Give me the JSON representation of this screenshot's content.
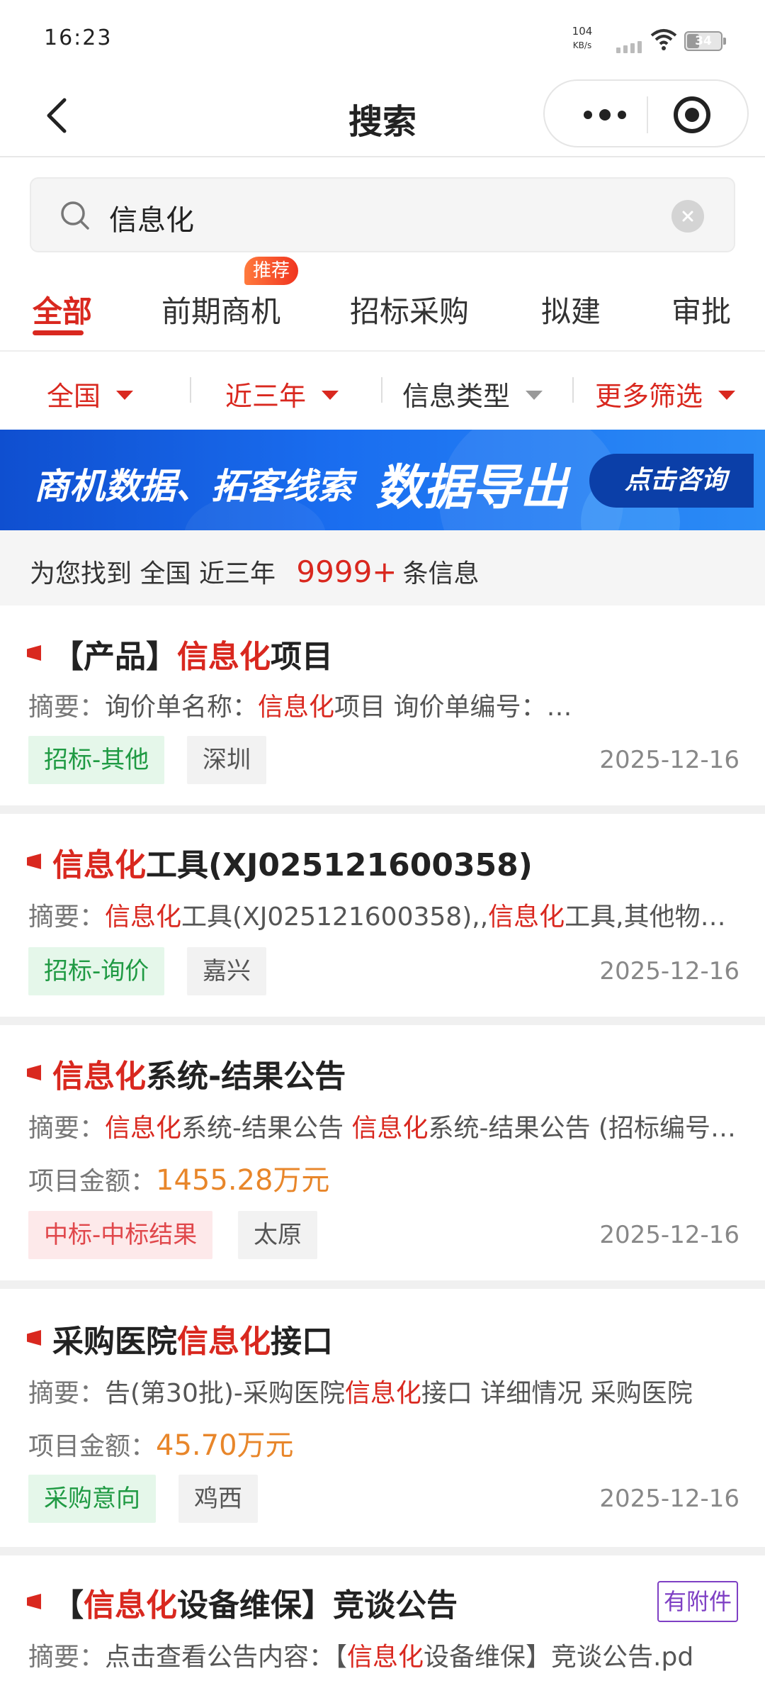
{
  "status_bar": {
    "time": "16:23",
    "net_speed": "104",
    "net_unit": "KB/s",
    "battery": "34"
  },
  "nav": {
    "title": "搜索"
  },
  "search": {
    "query": "信息化"
  },
  "tabs": [
    {
      "label": "全部",
      "active": true
    },
    {
      "label": "前期商机",
      "badge": "推荐"
    },
    {
      "label": "招标采购"
    },
    {
      "label": "拟建"
    },
    {
      "label": "审批"
    }
  ],
  "filters": {
    "region": "全国",
    "period": "近三年",
    "info_type": "信息类型",
    "more": "更多筛选"
  },
  "banner": {
    "text": "商机数据、拓客线索",
    "highlight": "数据导出",
    "button": "点击咨询"
  },
  "summary": {
    "prefix": "为您找到",
    "region": "全国",
    "period": "近三年",
    "count": "9999+",
    "suffix": "条信息"
  },
  "abstract_label": "摘要：",
  "amount_label": "项目金额：",
  "results": [
    {
      "title_parts": [
        "【产品】",
        "信息化",
        "项目"
      ],
      "abstract_parts": [
        "询价单名称：",
        "信息化",
        "项目 询价单编号：…"
      ],
      "tags": [
        "招标-其他",
        "深圳"
      ],
      "date": "2025-12-16"
    },
    {
      "title_parts": [
        "",
        "信息化",
        "工具(XJ025121600358)"
      ],
      "abstract_parts": [
        "",
        "信息化",
        "工具(XJ025121600358),,",
        "信息化",
        "工具,其他物资_…"
      ],
      "tags": [
        "招标-询价",
        "嘉兴"
      ],
      "date": "2025-12-16"
    },
    {
      "title_parts": [
        "",
        "信息化",
        "系统-结果公告"
      ],
      "abstract_parts": [
        "",
        "信息化",
        "系统-结果公告 ",
        "信息化",
        "系统-结果公告 (招标编号…"
      ],
      "amount": "1455.28万元",
      "tags": [
        "中标-中标结果",
        "太原"
      ],
      "date": "2025-12-16"
    },
    {
      "title_parts": [
        "采购医院",
        "信息化",
        "接口"
      ],
      "abstract_parts": [
        "告(第30批)-采购医院",
        "信息化",
        "接口 详细情况 采购医院"
      ],
      "amount": "45.70万元",
      "tags": [
        "采购意向",
        "鸡西"
      ],
      "date": "2025-12-16"
    },
    {
      "title_parts": [
        "【",
        "信息化",
        "设备维保】竞谈公告"
      ],
      "abstract_parts": [
        "点击查看公告内容：【",
        "信息化",
        "设备维保】竞谈公告.pd"
      ],
      "attachment": "有附件"
    }
  ],
  "colors": {
    "accent": "#d9281f",
    "banner": "#1a6ef0",
    "amount": "#e8862a",
    "attach": "#7e3fc4"
  }
}
